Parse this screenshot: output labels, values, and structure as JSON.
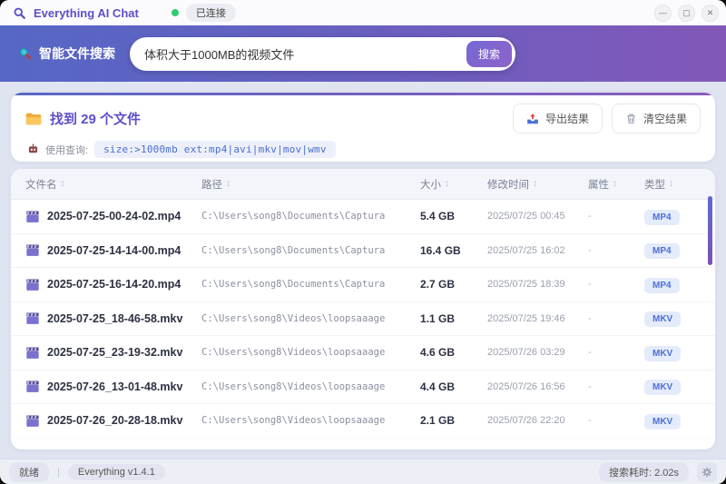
{
  "window": {
    "title": "Everything AI Chat",
    "connection_status": "已连接",
    "controls": {
      "minimize": "—",
      "maximize": "▢",
      "close": "✕"
    }
  },
  "icons": {
    "sort": "↕"
  },
  "search": {
    "label": "智能文件搜索",
    "value": "体积大于1000MB的视频文件",
    "button_label": "搜索"
  },
  "results": {
    "title": "找到 29 个文件",
    "query_label": "使用查询:",
    "query_value": "size:>1000mb ext:mp4|avi|mkv|mov|wmv",
    "export_label": "导出结果",
    "clear_label": "清空结果"
  },
  "table": {
    "columns": {
      "name": "文件名",
      "path": "路径",
      "size": "大小",
      "modified": "修改时间",
      "attr": "属性",
      "type": "类型"
    },
    "rows": [
      {
        "name": "2025-07-25-00-24-02.mp4",
        "path": "C:\\Users\\song8\\Documents\\Captura",
        "size": "5.4 GB",
        "modified": "2025/07/25 00:45",
        "attr": "-",
        "type": "MP4"
      },
      {
        "name": "2025-07-25-14-14-00.mp4",
        "path": "C:\\Users\\song8\\Documents\\Captura",
        "size": "16.4 GB",
        "modified": "2025/07/25 16:02",
        "attr": "-",
        "type": "MP4"
      },
      {
        "name": "2025-07-25-16-14-20.mp4",
        "path": "C:\\Users\\song8\\Documents\\Captura",
        "size": "2.7 GB",
        "modified": "2025/07/25 18:39",
        "attr": "-",
        "type": "MP4"
      },
      {
        "name": "2025-07-25_18-46-58.mkv",
        "path": "C:\\Users\\song8\\Videos\\loopsaaage",
        "size": "1.1 GB",
        "modified": "2025/07/25 19:46",
        "attr": "-",
        "type": "MKV"
      },
      {
        "name": "2025-07-25_23-19-32.mkv",
        "path": "C:\\Users\\song8\\Videos\\loopsaaage",
        "size": "4.6 GB",
        "modified": "2025/07/26 03:29",
        "attr": "-",
        "type": "MKV"
      },
      {
        "name": "2025-07-26_13-01-48.mkv",
        "path": "C:\\Users\\song8\\Videos\\loopsaaage",
        "size": "4.4 GB",
        "modified": "2025/07/26 16:56",
        "attr": "-",
        "type": "MKV"
      },
      {
        "name": "2025-07-26_20-28-18.mkv",
        "path": "C:\\Users\\song8\\Videos\\loopsaaage",
        "size": "2.1 GB",
        "modified": "2025/07/26 22:20",
        "attr": "-",
        "type": "MKV"
      }
    ]
  },
  "statusbar": {
    "state": "就绪",
    "version": "Everything v1.4.1",
    "elapsed": "搜索耗时: 2.02s"
  },
  "colors": {
    "accent": "#5b50c8",
    "gradient_start": "#5667c4",
    "gradient_end": "#8257b8",
    "badge_bg": "#e4ebfa",
    "badge_text": "#4d6fd6",
    "connected_dot": "#2ecc71"
  }
}
